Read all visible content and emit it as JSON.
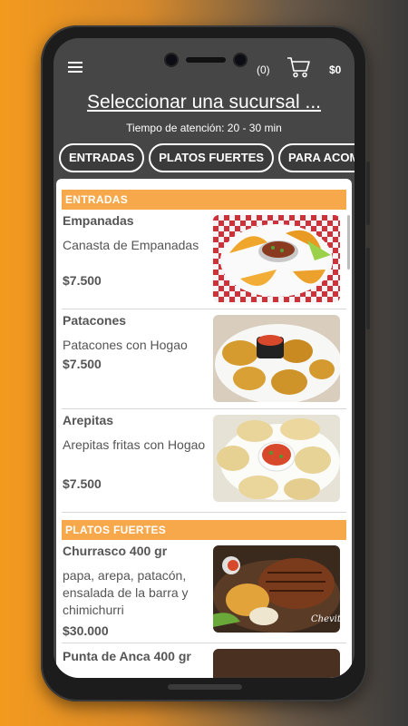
{
  "header": {
    "cart_count": "(0)",
    "cart_total": "$0",
    "branch_label": "Seleccionar una sucursal ...",
    "wait_time": "Tiempo de atención: 20 - 30 min"
  },
  "tabs": [
    "ENTRADAS",
    "PLATOS FUERTES",
    "PARA ACOMPAÑAR"
  ],
  "menu": {
    "entradas": {
      "title": "ENTRADAS",
      "items": [
        {
          "name": "Empanadas",
          "description": "Canasta de Empanadas",
          "price": "$7.500"
        },
        {
          "name": "Patacones",
          "description": "Patacones con Hogao",
          "price": "$7.500"
        },
        {
          "name": "Arepitas",
          "description": "Arepitas fritas con Hogao",
          "price": "$7.500"
        }
      ]
    },
    "platos_fuertes": {
      "title": "PLATOS FUERTES",
      "items": [
        {
          "name": "Churrasco 400 gr",
          "description": "papa, arepa, patacón, ensalada de la barra y chimichurri",
          "price": "$30.000",
          "watermark": "Chevita"
        },
        {
          "name": "Punta de Anca 400 gr"
        }
      ]
    }
  },
  "icons": {
    "menu": "hamburger-menu-icon",
    "cart": "shopping-cart-icon"
  },
  "colors": {
    "accent": "#f7a84a",
    "header_bg": "#464646"
  }
}
